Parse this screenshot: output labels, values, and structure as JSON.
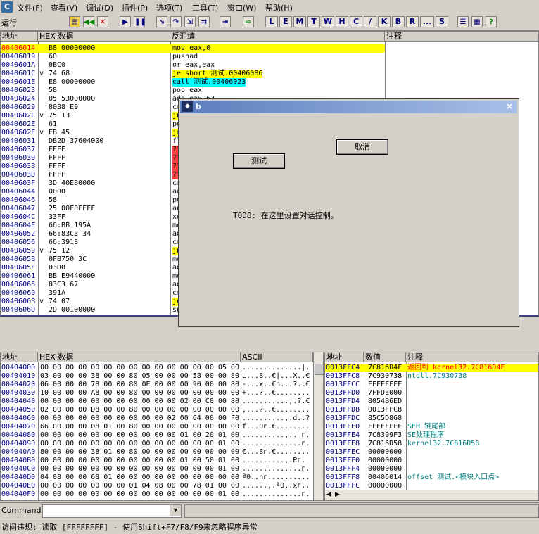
{
  "menubar": {
    "items": [
      "文件(F)",
      "查看(V)",
      "调试(D)",
      "插件(P)",
      "选项(T)",
      "工具(T)",
      "窗口(W)",
      "帮助(H)"
    ]
  },
  "toolbar": {
    "status": "运行",
    "letters": [
      "L",
      "E",
      "M",
      "T",
      "W",
      "H",
      "C",
      "/",
      "K",
      "B",
      "R",
      "...",
      "S"
    ]
  },
  "disasm": {
    "headers": {
      "addr": "地址",
      "hex": "HEX 数据",
      "asm": "反汇编",
      "comment": "注释"
    },
    "rows": [
      {
        "addr": "00406014",
        "mark": "",
        "hex": "B8 00000000",
        "asm": "mov eax,0"
      },
      {
        "addr": "00406019",
        "mark": "",
        "hex": "60",
        "asm": "pushad"
      },
      {
        "addr": "0040601A",
        "mark": "",
        "hex": "0BC0",
        "asm": "or eax,eax"
      },
      {
        "addr": "0040601C",
        "mark": "v",
        "hex": "74 68",
        "asm": "je short 测试.00406086"
      },
      {
        "addr": "0040601E",
        "mark": "",
        "hex": "E8 00000000",
        "asm": "call 测试.00406023"
      },
      {
        "addr": "00406023",
        "mark": "",
        "hex": "58",
        "asm": "pop eax"
      },
      {
        "addr": "00406024",
        "mark": "",
        "hex": "05 53000000",
        "asm": "add eax,53"
      },
      {
        "addr": "00406029",
        "mark": "",
        "hex": "8038 E9",
        "asm": "cmp byte ptr"
      },
      {
        "addr": "0040602C",
        "mark": "v",
        "hex": "75 13",
        "asm": "jnz"
      },
      {
        "addr": "0040602E",
        "mark": "",
        "hex": "61",
        "asm": "popad"
      },
      {
        "addr": "0040602F",
        "mark": "v",
        "hex": "EB 45",
        "asm": "jmp"
      },
      {
        "addr": "00406031",
        "mark": "",
        "hex": "DB2D 37604000",
        "asm": "fld"
      },
      {
        "addr": "00406037",
        "mark": "",
        "hex": "FFFF",
        "asm": "???"
      },
      {
        "addr": "00406039",
        "mark": "",
        "hex": "FFFF",
        "asm": "???"
      },
      {
        "addr": "0040603B",
        "mark": "",
        "hex": "FFFF",
        "asm": "???"
      },
      {
        "addr": "0040603D",
        "mark": "",
        "hex": "FFFF",
        "asm": "???"
      },
      {
        "addr": "0040603F",
        "mark": "",
        "hex": "3D 40E80000",
        "asm": "cmp"
      },
      {
        "addr": "00406044",
        "mark": "",
        "hex": "0000",
        "asm": "add"
      },
      {
        "addr": "00406046",
        "mark": "",
        "hex": "58",
        "asm": "pop"
      },
      {
        "addr": "00406047",
        "mark": "",
        "hex": "25 00F0FFFF",
        "asm": "and"
      },
      {
        "addr": "0040604C",
        "mark": "",
        "hex": "33FF",
        "asm": "xor"
      },
      {
        "addr": "0040604E",
        "mark": "",
        "hex": "66:BB 195A",
        "asm": "mov"
      },
      {
        "addr": "00406052",
        "mark": "",
        "hex": "66:83C3 34",
        "asm": "add"
      },
      {
        "addr": "00406056",
        "mark": "",
        "hex": "66:3918",
        "asm": "cmp"
      },
      {
        "addr": "00406059",
        "mark": "v",
        "hex": "75 12",
        "asm": "jnz"
      },
      {
        "addr": "0040605B",
        "mark": "",
        "hex": "0FB750 3C",
        "asm": "movzx"
      },
      {
        "addr": "0040605F",
        "mark": "",
        "hex": "03D0",
        "asm": "add"
      },
      {
        "addr": "00406061",
        "mark": "",
        "hex": "BB E9440000",
        "asm": "mov"
      },
      {
        "addr": "00406066",
        "mark": "",
        "hex": "83C3 67",
        "asm": "add"
      },
      {
        "addr": "00406069",
        "mark": "",
        "hex": "391A",
        "asm": "cmp"
      },
      {
        "addr": "0040606B",
        "mark": "v",
        "hex": "74 07",
        "asm": "je"
      },
      {
        "addr": "0040606D",
        "mark": "",
        "hex": "2D 00100000",
        "asm": "sub"
      }
    ]
  },
  "dump": {
    "headers": {
      "addr": "地址",
      "hex": "HEX 数据",
      "ascii": "ASCII"
    },
    "rows": [
      {
        "addr": "00404000",
        "hex": "00 00 00 00 00 00 00 00 00 00 00 00 00 00 05 00",
        "ascii": "..............|."
      },
      {
        "addr": "00404010",
        "hex": "03 00 00 00 38 00 00 80 05 00 00 00 58 00 00 80",
        "ascii": "L...8..€|...X..€"
      },
      {
        "addr": "00404020",
        "hex": "06 00 00 00 78 00 00 80 0E 00 00 00 90 00 00 80",
        "ascii": "-...x..€n...?..€"
      },
      {
        "addr": "00404030",
        "hex": "10 00 00 00 A8 00 00 80 00 00 00 00 00 00 00 00",
        "ascii": "+...?..€........"
      },
      {
        "addr": "00404040",
        "hex": "00 00 00 00 00 00 00 00 00 00 00 02 00 C0 00 80",
        "ascii": "...........,.?.€"
      },
      {
        "addr": "00404050",
        "hex": "02 00 00 00 D8 00 00 80 00 00 00 00 00 00 00 00",
        "ascii": ",...?..€........"
      },
      {
        "addr": "00404060",
        "hex": "00 00 00 00 00 00 00 00 00 00 02 00 64 00 00 F0",
        "ascii": "..........,.d..?"
      },
      {
        "addr": "00404070",
        "hex": "66 00 00 00 08 01 00 80 00 00 00 00 00 00 00 00",
        "ascii": "f...0г.€........"
      },
      {
        "addr": "00404080",
        "hex": "00 00 00 00 00 00 00 00 00 00 00 01 00 20 01 00",
        "ascii": "..........,.. г."
      },
      {
        "addr": "00404090",
        "hex": "00 00 00 00 00 00 00 00 00 00 00 00 00 00 01 00",
        "ascii": "..............г."
      },
      {
        "addr": "004040A0",
        "hex": "80 00 00 00 38 01 00 80 00 00 00 00 00 00 00 00",
        "ascii": "€...8г.€........"
      },
      {
        "addr": "004040B0",
        "hex": "00 00 00 00 00 00 00 00 00 00 00 01 00 50 01 00",
        "ascii": "..........,.Pг."
      },
      {
        "addr": "004040C0",
        "hex": "00 00 00 00 00 00 00 00 00 00 00 00 00 00 01 00",
        "ascii": "..............г."
      },
      {
        "addr": "004040D0",
        "hex": "04 08 00 00 68 01 00 00 00 00 00 00 00 00 00 00",
        "ascii": "ª0..hг.........."
      },
      {
        "addr": "004040E0",
        "hex": "00 00 00 00 00 00 00 01 04 08 00 00 78 01 00 00",
        "ascii": "......,.ª0..xг.."
      },
      {
        "addr": "004040F0",
        "hex": "00 00 00 00 00 00 00 00 00 00 00 00 00 00 01 00",
        "ascii": "..............г."
      }
    ]
  },
  "stack": {
    "headers": {
      "addr": "地址",
      "value": "数值",
      "comment": "注释"
    },
    "rows": [
      {
        "addr": "0013FFC4",
        "value": "7C816D4F",
        "comment": "返回到 kernel32.7C816D4F"
      },
      {
        "addr": "0013FFC8",
        "value": "7C930738",
        "comment": "ntdll.7C930738"
      },
      {
        "addr": "0013FFCC",
        "value": "FFFFFFFF",
        "comment": ""
      },
      {
        "addr": "0013FFD0",
        "value": "7FFDE000",
        "comment": ""
      },
      {
        "addr": "0013FFD4",
        "value": "8054B6ED",
        "comment": ""
      },
      {
        "addr": "0013FFD8",
        "value": "0013FFC8",
        "comment": ""
      },
      {
        "addr": "0013FFDC",
        "value": "85C5D868",
        "comment": ""
      },
      {
        "addr": "0013FFE0",
        "value": "FFFFFFFF",
        "comment": "SEH 链尾部"
      },
      {
        "addr": "0013FFE4",
        "value": "7C8399F3",
        "comment": "SE处理程序"
      },
      {
        "addr": "0013FFE8",
        "value": "7C816D58",
        "comment": "kernel32.7C816D58"
      },
      {
        "addr": "0013FFEC",
        "value": "00000000",
        "comment": ""
      },
      {
        "addr": "0013FFF0",
        "value": "00000000",
        "comment": ""
      },
      {
        "addr": "0013FFF4",
        "value": "00000000",
        "comment": ""
      },
      {
        "addr": "0013FFF8",
        "value": "00406014",
        "comment": "offset 测试.<模块入口点>"
      },
      {
        "addr": "0013FFFC",
        "value": "00000000",
        "comment": ""
      }
    ]
  },
  "dialog": {
    "title": "b",
    "test_button": "测试",
    "cancel_button": "取消",
    "message": "TODO: 在这里设置对话控制。"
  },
  "command": {
    "label": "Command :",
    "value": ""
  },
  "statusbar": {
    "text": "访问违规: 读取 [FFFFFFFF] - 使用Shift+F7/F8/F9来忽略程序异常"
  }
}
